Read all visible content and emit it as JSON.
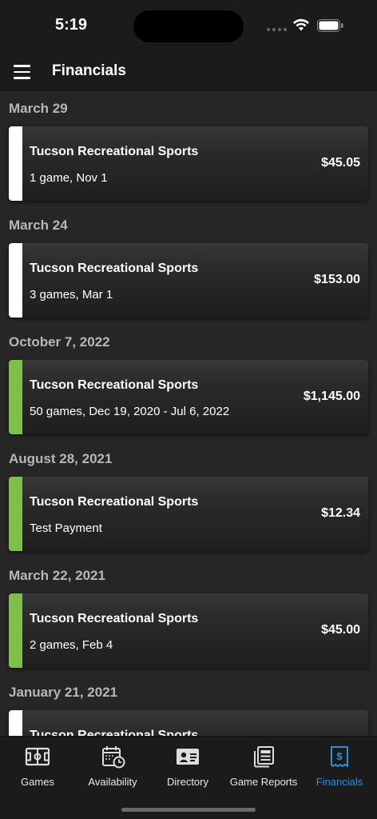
{
  "status": {
    "time": "5:19",
    "icons": [
      "signal-dots-icon",
      "wifi-icon",
      "battery-icon"
    ]
  },
  "header": {
    "title": "Financials",
    "menu_icon": "hamburger-menu-icon"
  },
  "colors": {
    "paid_bar": "#7cc04a",
    "pending_bar": "#ffffff",
    "active_tab": "#2f8fd8"
  },
  "payments": [
    {
      "date": "March 29",
      "org": "Tucson Recreational Sports",
      "detail": "1 game, Nov 1",
      "amount": "$45.05",
      "status_color": "#ffffff"
    },
    {
      "date": "March 24",
      "org": "Tucson Recreational Sports",
      "detail": "3 games, Mar 1",
      "amount": "$153.00",
      "status_color": "#ffffff"
    },
    {
      "date": "October 7, 2022",
      "org": "Tucson Recreational Sports",
      "detail": "50 games, Dec 19, 2020 - Jul 6, 2022",
      "amount": "$1,145.00",
      "status_color": "#7cc04a"
    },
    {
      "date": "August 28, 2021",
      "org": "Tucson Recreational Sports",
      "detail": "Test Payment",
      "amount": "$12.34",
      "status_color": "#7cc04a"
    },
    {
      "date": "March 22, 2021",
      "org": "Tucson Recreational Sports",
      "detail": "2 games, Feb 4",
      "amount": "$45.00",
      "status_color": "#7cc04a"
    },
    {
      "date": "January 21, 2021",
      "org": "Tucson Recreational Sports",
      "detail": "",
      "amount": "",
      "status_color": "#ffffff"
    }
  ],
  "tabs": [
    {
      "label": "Games",
      "icon": "field-icon",
      "active": false
    },
    {
      "label": "Availability",
      "icon": "calendar-clock-icon",
      "active": false
    },
    {
      "label": "Directory",
      "icon": "contact-card-icon",
      "active": false
    },
    {
      "label": "Game Reports",
      "icon": "reports-icon",
      "active": false
    },
    {
      "label": "Financials",
      "icon": "receipt-dollar-icon",
      "active": true
    }
  ]
}
